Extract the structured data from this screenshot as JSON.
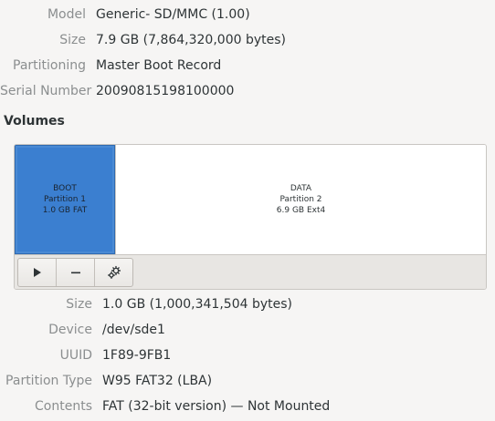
{
  "drive": {
    "rows": [
      {
        "label": "Model",
        "value": "Generic- SD/MMC (1.00)"
      },
      {
        "label": "Size",
        "value": "7.9 GB (7,864,320,000 bytes)"
      },
      {
        "label": "Partitioning",
        "value": "Master Boot Record"
      },
      {
        "label": "Serial Number",
        "value": "20090815198100000"
      }
    ]
  },
  "volumes": {
    "title": "Volumes",
    "partitions": [
      {
        "name": "BOOT",
        "number": "Partition 1",
        "info": "1.0 GB FAT",
        "selected": true
      },
      {
        "name": "DATA",
        "number": "Partition 2",
        "info": "6.9 GB Ext4",
        "selected": false
      }
    ],
    "toolbar": [
      {
        "icon": "play-icon"
      },
      {
        "icon": "minus-icon"
      },
      {
        "icon": "gears-icon"
      }
    ],
    "colors": {
      "selected": "#3b7fd0"
    }
  },
  "partition_details": {
    "rows": [
      {
        "label": "Size",
        "value": "1.0 GB (1,000,341,504 bytes)"
      },
      {
        "label": "Device",
        "value": "/dev/sde1"
      },
      {
        "label": "UUID",
        "value": "1F89-9FB1"
      },
      {
        "label": "Partition Type",
        "value": "W95 FAT32 (LBA)"
      },
      {
        "label": "Contents",
        "value": "FAT (32-bit version) — Not Mounted"
      }
    ]
  }
}
